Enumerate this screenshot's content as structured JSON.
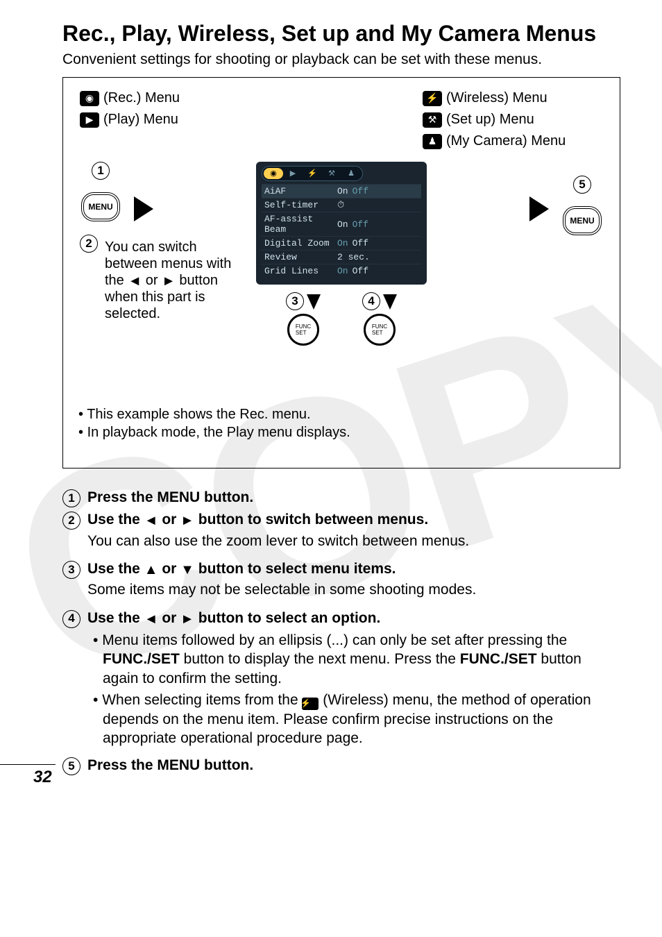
{
  "title": "Rec., Play, Wireless, Set up and My Camera Menus",
  "intro": "Convenient settings for shooting or playback can be set with these menus.",
  "diagram": {
    "rec_label": "(Rec.) Menu",
    "play_label": "(Play) Menu",
    "wireless_label": "(Wireless) Menu",
    "setup_label": "(Set up) Menu",
    "mycamera_label": "(My Camera) Menu",
    "menu_btn": "MENU",
    "switch_note_pre": "You can switch between menus with the ",
    "switch_note_mid": " or ",
    "switch_note_post": " button when this part is selected.",
    "lcd": {
      "rows": [
        {
          "label": "AiAF",
          "on": "On",
          "off": "Off",
          "hl": true
        },
        {
          "label": "Self-timer",
          "on": "",
          "off": ""
        },
        {
          "label": "AF-assist Beam",
          "on": "On",
          "off": "Off"
        },
        {
          "label": "Digital Zoom",
          "on": "On",
          "off": "Off"
        },
        {
          "label": "Review",
          "on": "",
          "off": "2 sec."
        },
        {
          "label": "Grid Lines",
          "on": "On",
          "off": "Off"
        }
      ]
    },
    "notes": [
      "This example shows the Rec. menu.",
      "In playback mode, the Play menu displays."
    ]
  },
  "steps": {
    "s1": "Press the MENU button.",
    "s2_pre": "Use the ",
    "s2_mid": " or ",
    "s2_post": " button to switch between menus.",
    "s2_sub": "You can also use the zoom lever to switch between menus.",
    "s3_pre": "Use the ",
    "s3_mid": " or ",
    "s3_post": " button to select menu items.",
    "s3_sub": "Some items may not be selectable in some shooting modes.",
    "s4_pre": "Use the ",
    "s4_mid": " or ",
    "s4_post": " button to select an option.",
    "s4_b1_a": "Menu items followed by an ellipsis (...) can only be set after pressing the ",
    "s4_b1_b": "FUNC./SET",
    "s4_b1_c": " button to display the next menu. Press the ",
    "s4_b1_d": "FUNC./SET",
    "s4_b1_e": " button again to confirm the setting.",
    "s4_b2_a": "When selecting items from the ",
    "s4_b2_b": " (Wireless) menu, the method of operation depends on the menu item. Please confirm precise instructions on the appropriate operational procedure page.",
    "s5": "Press the MENU button."
  },
  "page_number": "32",
  "watermark": "COPY"
}
